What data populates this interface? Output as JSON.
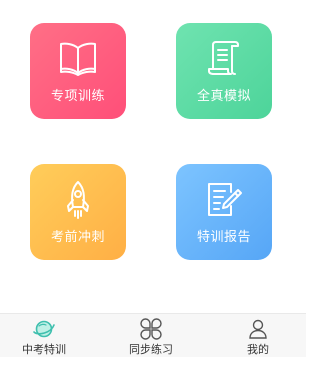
{
  "tiles": [
    {
      "label": "专项训练",
      "icon": "open-book-icon"
    },
    {
      "label": "全真模拟",
      "icon": "scroll-icon"
    },
    {
      "label": "考前冲刺",
      "icon": "rocket-icon"
    },
    {
      "label": "特训报告",
      "icon": "report-edit-icon"
    }
  ],
  "tabbar": {
    "items": [
      {
        "label": "中考特训",
        "icon": "planet-icon",
        "active": true
      },
      {
        "label": "同步练习",
        "icon": "four-petal-icon",
        "active": false
      },
      {
        "label": "我的",
        "icon": "user-icon",
        "active": false
      }
    ]
  },
  "colors": {
    "tile_pink": "#ff5a7e",
    "tile_green": "#5adba3",
    "tile_orange": "#ffbe4f",
    "tile_blue": "#66b1fa",
    "tab_active_icon": "#4fc9b8",
    "tab_icon": "#555555"
  }
}
